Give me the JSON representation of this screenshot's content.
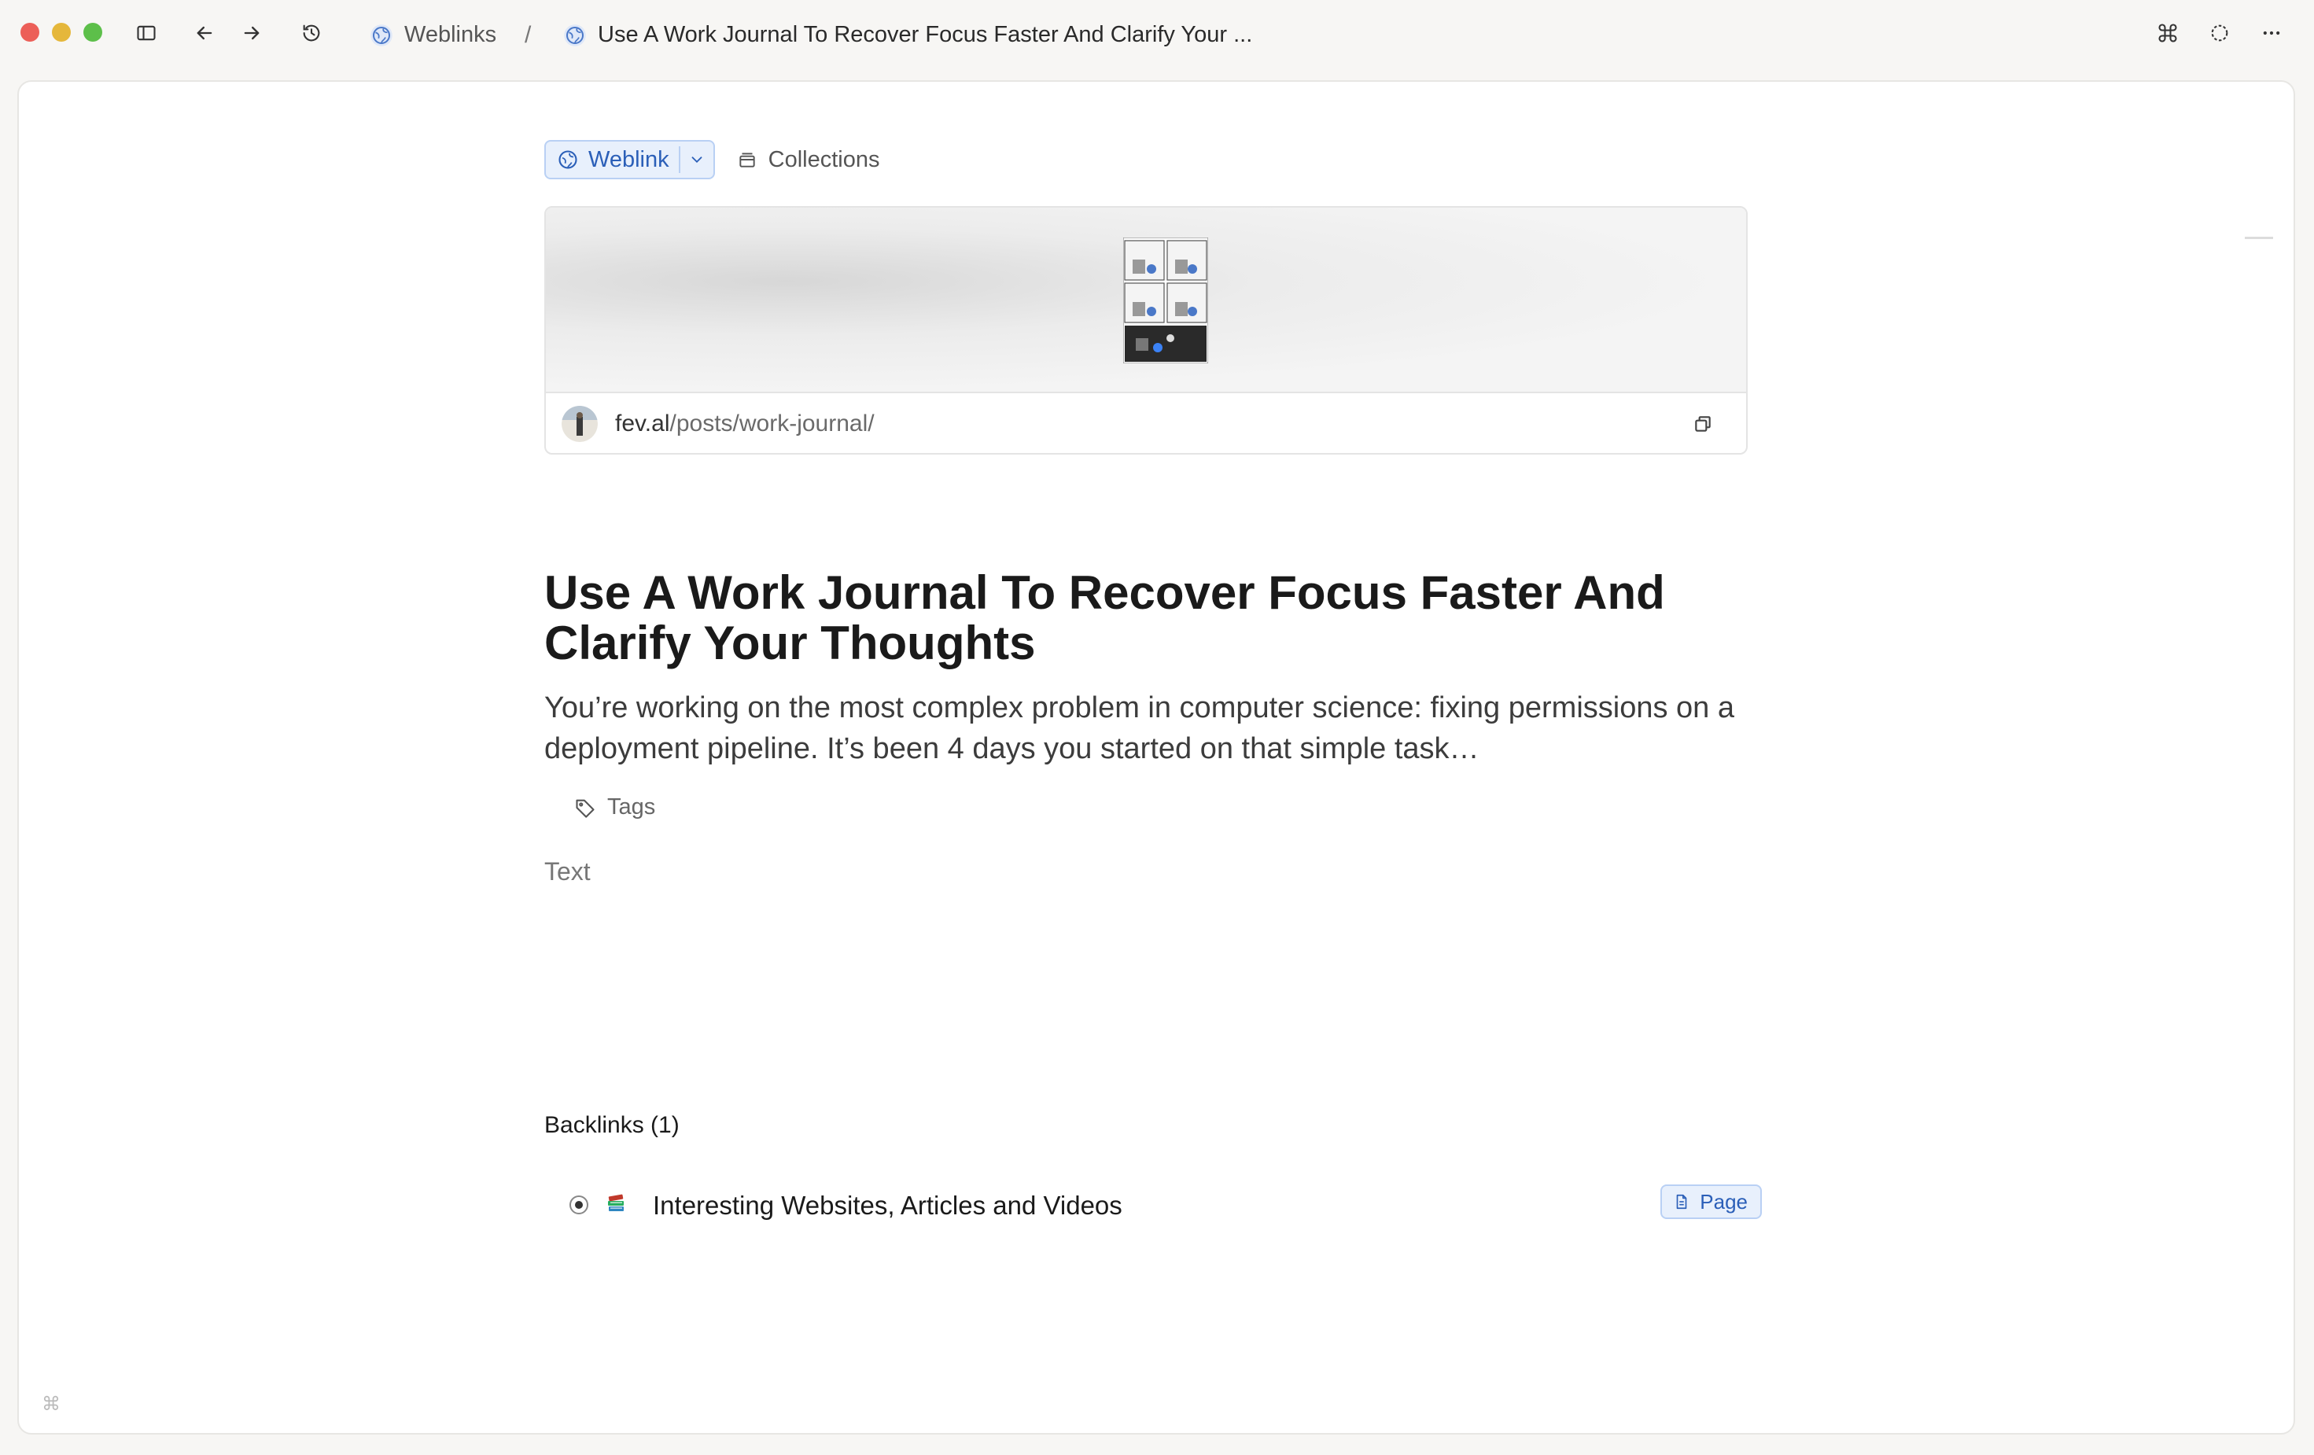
{
  "window": {
    "breadcrumb": {
      "parent": "Weblinks",
      "separator": "/",
      "current": "Use A Work Journal To Recover Focus Faster And Clarify Your ..."
    }
  },
  "object_type": {
    "label": "Weblink",
    "collections_label": "Collections"
  },
  "link_card": {
    "domain": "fev.al",
    "path": "/posts/work-journal/"
  },
  "page": {
    "title": "Use A Work Journal To Recover Focus Faster And Clarify Your Thoughts",
    "description": "You’re working on the most complex problem in computer science: fixing permissions on a deployment pipeline. It’s been 4 days you started on that simple task…",
    "tags_label": "Tags",
    "text_placeholder": "Text"
  },
  "backlinks": {
    "heading": "Backlinks (1)",
    "items": [
      {
        "label": "Interesting Websites, Articles and Videos",
        "badge": "Page",
        "icon": "books-emoji"
      }
    ]
  },
  "colors": {
    "accent": "#2b5fb8",
    "accent_bg": "#e8f0fc",
    "close": "#ec5f58",
    "minimize": "#e5b73b",
    "maximize": "#5dbf4a"
  },
  "footer": {
    "shortcut_glyph": "⌘"
  }
}
